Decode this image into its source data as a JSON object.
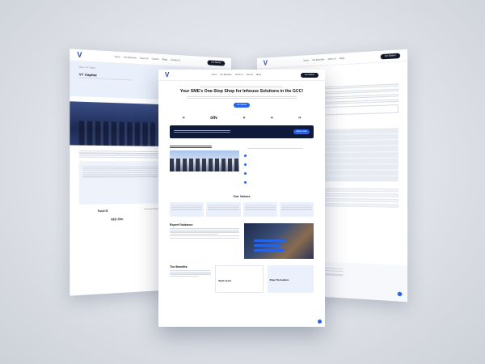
{
  "left_page": {
    "breadcrumb": "Home / VT Capital",
    "title": "VT Capital",
    "stats": [
      "Fund III",
      "Investment Period",
      "Capital Structure",
      "AED 25m",
      "AED 10m"
    ]
  },
  "right_page": {
    "title": "Contact Us"
  },
  "center_page": {
    "hero_title": "Your SME's One-Stop Shop for Inhouse Solutions in the GCC!",
    "brand_logo_text": "oliv",
    "values_title": "Our Values",
    "expert_title": "Expert Guidance",
    "benefits_title": "The Benefits",
    "benefit_cards": [
      "Rapid Launch",
      "Shape The Guidance"
    ]
  }
}
